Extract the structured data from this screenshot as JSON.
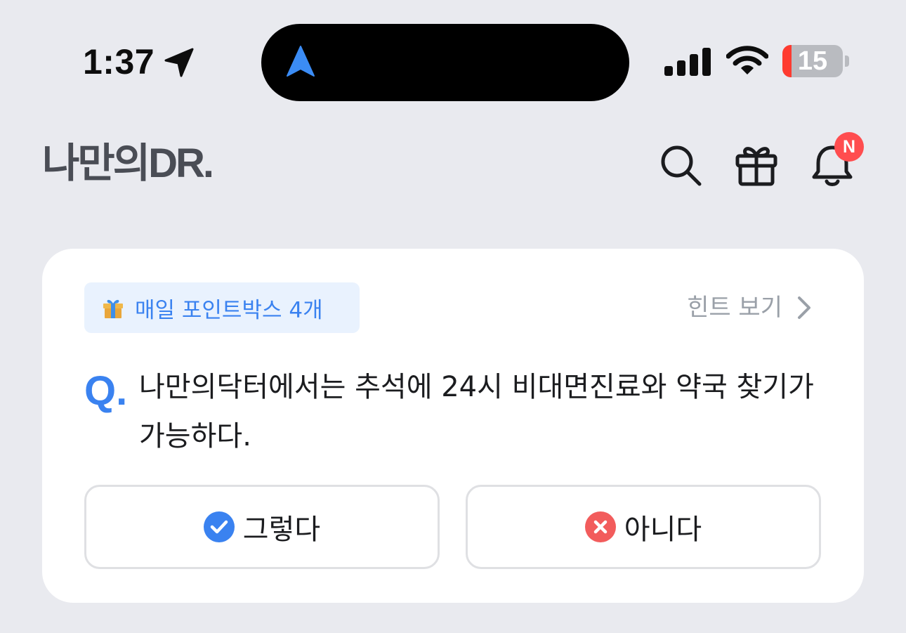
{
  "status_bar": {
    "time": "1:37",
    "battery": "15",
    "battery_level": 0.15,
    "icons": [
      "location-arrow-icon",
      "navigation-arrow-icon",
      "cellular-signal-icon",
      "wifi-icon",
      "battery-icon"
    ]
  },
  "header": {
    "logo": "나만의DR.",
    "icons": [
      "search-icon",
      "gift-icon",
      "bell-icon"
    ],
    "notification_badge": "N"
  },
  "quiz": {
    "chip_label": "매일 포인트박스 4개",
    "hint_label": "힌트 보기",
    "q_mark": "Q.",
    "question": "나만의닥터에서는 추석에 24시 비대면진료와 약국 찾기가 가능하다.",
    "answer_yes": "그렇다",
    "answer_no": "아니다"
  },
  "colors": {
    "accent_blue": "#3a82f0",
    "chip_bg": "#e9f2fe",
    "badge_red": "#ff4d4f",
    "no_red": "#f25c5c",
    "page_bg": "#e9eaef"
  }
}
